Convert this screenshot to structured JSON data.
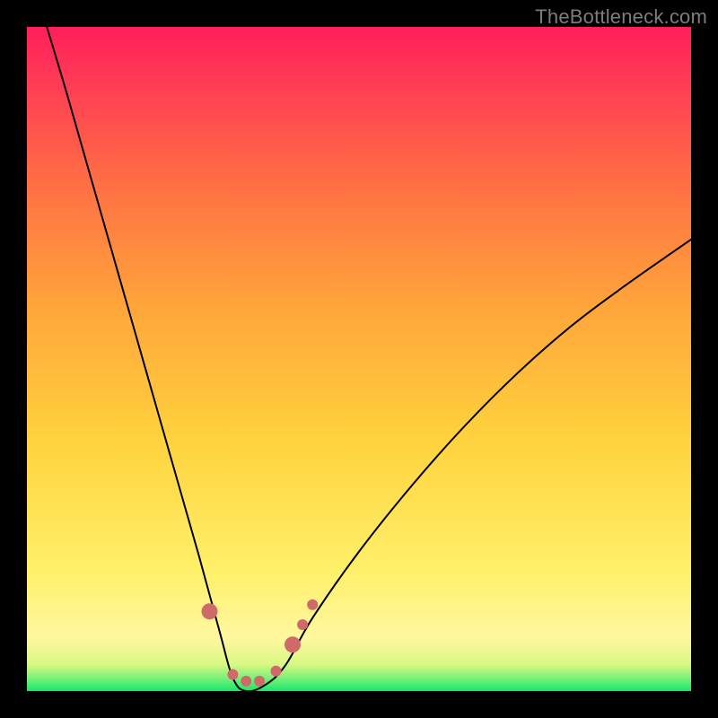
{
  "watermark": "TheBottleneck.com",
  "chart_data": {
    "type": "line",
    "title": "",
    "xlabel": "",
    "ylabel": "",
    "xlim": [
      0,
      100
    ],
    "ylim": [
      0,
      100
    ],
    "grid": false,
    "legend": false,
    "note": "Axes are normalized 0–100; y=0 is the green band (no bottleneck), y→100 is red (severe bottleneck). x-axis is relative hardware balance with the optimum near x≈33.",
    "background_gradient": {
      "stops": [
        {
          "y": 0,
          "color": "#17e869"
        },
        {
          "y": 2,
          "color": "#7df07a"
        },
        {
          "y": 4,
          "color": "#d9f783"
        },
        {
          "y": 8,
          "color": "#fff7a0"
        },
        {
          "y": 18,
          "color": "#fff06a"
        },
        {
          "y": 38,
          "color": "#ffd23d"
        },
        {
          "y": 58,
          "color": "#ffa53a"
        },
        {
          "y": 78,
          "color": "#ff6a45"
        },
        {
          "y": 92,
          "color": "#ff3a56"
        },
        {
          "y": 100,
          "color": "#ff1f5a"
        }
      ]
    },
    "series": [
      {
        "name": "bottleneck-curve",
        "color": "#000000",
        "stroke_width": 2,
        "points": [
          {
            "x": 3,
            "y": 100
          },
          {
            "x": 6,
            "y": 90
          },
          {
            "x": 10,
            "y": 76
          },
          {
            "x": 14,
            "y": 62
          },
          {
            "x": 18,
            "y": 48
          },
          {
            "x": 22,
            "y": 34
          },
          {
            "x": 26,
            "y": 20
          },
          {
            "x": 29,
            "y": 9
          },
          {
            "x": 31,
            "y": 2
          },
          {
            "x": 33,
            "y": 0
          },
          {
            "x": 36,
            "y": 1
          },
          {
            "x": 39,
            "y": 4
          },
          {
            "x": 43,
            "y": 11
          },
          {
            "x": 50,
            "y": 21
          },
          {
            "x": 58,
            "y": 31
          },
          {
            "x": 66,
            "y": 40
          },
          {
            "x": 74,
            "y": 48
          },
          {
            "x": 82,
            "y": 55
          },
          {
            "x": 90,
            "y": 61
          },
          {
            "x": 100,
            "y": 68
          }
        ]
      }
    ],
    "markers": {
      "name": "highlighted-points",
      "color": "#cf6a6a",
      "radius_small": 6,
      "radius_large": 9,
      "points": [
        {
          "x": 27.5,
          "y": 12,
          "size": "large"
        },
        {
          "x": 31,
          "y": 2.5,
          "size": "small"
        },
        {
          "x": 33,
          "y": 1.5,
          "size": "small"
        },
        {
          "x": 35,
          "y": 1.5,
          "size": "small"
        },
        {
          "x": 37.5,
          "y": 3,
          "size": "small"
        },
        {
          "x": 40,
          "y": 7,
          "size": "large"
        },
        {
          "x": 41.5,
          "y": 10,
          "size": "small"
        },
        {
          "x": 43,
          "y": 13,
          "size": "small"
        }
      ]
    }
  }
}
